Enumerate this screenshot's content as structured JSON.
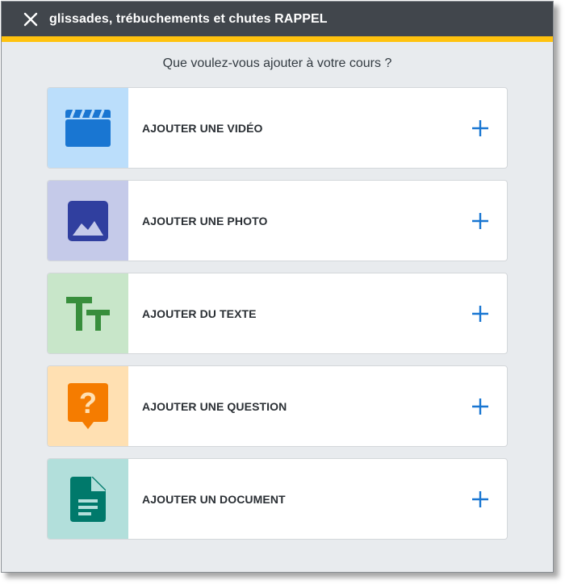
{
  "header": {
    "title": "glissades, trébuchements et chutes RAPPEL",
    "close_icon": "close-icon"
  },
  "prompt": "Que voulez-vous ajouter à votre cours ?",
  "colors": {
    "header_bg": "#41464c",
    "header_accent": "#ffc20e",
    "plus_color": "#1976d2"
  },
  "options": [
    {
      "label": "AJOUTER UNE VIDÉO",
      "icon": "video-clapper-icon",
      "tile_color": "#bbdefb",
      "icon_color": "#1976d2"
    },
    {
      "label": "AJOUTER UNE PHOTO",
      "icon": "image-icon",
      "tile_color": "#c5cae9",
      "icon_color": "#303f9f"
    },
    {
      "label": "AJOUTER DU TEXTE",
      "icon": "text-size-icon",
      "tile_color": "#c8e6c9",
      "icon_color": "#388e3c"
    },
    {
      "label": "AJOUTER UNE QUESTION",
      "icon": "question-bubble-icon",
      "tile_color": "#ffe0b2",
      "icon_color": "#f57c00"
    },
    {
      "label": "AJOUTER UN DOCUMENT",
      "icon": "document-icon",
      "tile_color": "#b2dfdb",
      "icon_color": "#00796b"
    }
  ]
}
